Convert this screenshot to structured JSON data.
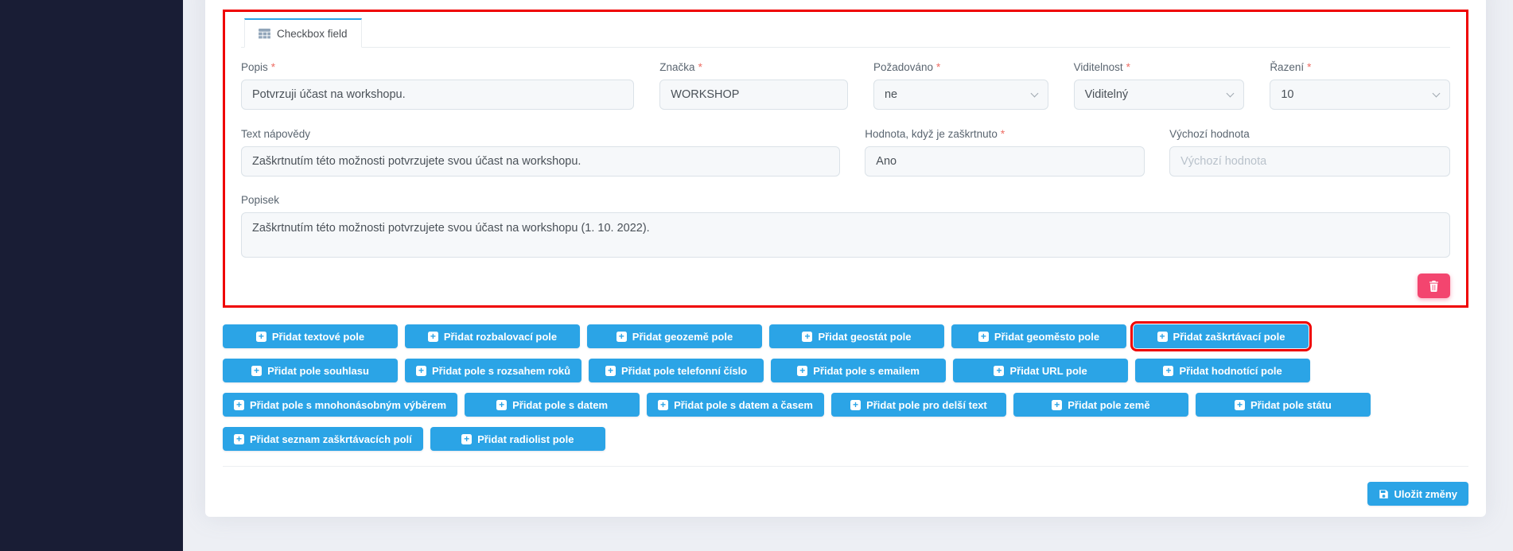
{
  "panel": {
    "tab_label": "Checkbox field"
  },
  "icons": {
    "plus": "+"
  },
  "form": {
    "required_marker": "*",
    "fields": {
      "popis": {
        "label": "Popis",
        "value": "Potvrzuji účast na workshopu."
      },
      "znacka": {
        "label": "Značka",
        "value": "WORKSHOP"
      },
      "pozadovano": {
        "label": "Požadováno",
        "value": "ne"
      },
      "viditelnost": {
        "label": "Viditelnost",
        "value": "Viditelný"
      },
      "razeni": {
        "label": "Řazení",
        "value": "10"
      },
      "text_napovedy": {
        "label": "Text nápovědy",
        "value": "Zaškrtnutím této možnosti potvrzujete svou účast na workshopu."
      },
      "hodnota_zaskrtnuto": {
        "label": "Hodnota, když je zaškrtnuto",
        "value": "Ano"
      },
      "vychozi_hodnota": {
        "label": "Výchozí hodnota",
        "value": "",
        "placeholder": "Výchozí hodnota"
      },
      "popisek": {
        "label": "Popisek",
        "value": "Zaškrtnutím této možnosti potvrzujete svou účast na workshopu (1. 10. 2022)."
      }
    }
  },
  "add_buttons": [
    {
      "label": "Přidat textové pole"
    },
    {
      "label": "Přidat rozbalovací pole"
    },
    {
      "label": "Přidat geozemě pole"
    },
    {
      "label": "Přidat geostát pole"
    },
    {
      "label": "Přidat geoměsto pole"
    },
    {
      "label": "Přidat zaškrtávací pole",
      "highlighted": true
    },
    {
      "label": "Přidat pole souhlasu"
    },
    {
      "label": "Přidat pole s rozsahem roků"
    },
    {
      "label": "Přidat pole telefonní číslo"
    },
    {
      "label": "Přidat pole s emailem"
    },
    {
      "label": "Přidat URL pole"
    },
    {
      "label": "Přidat hodnotící pole"
    },
    {
      "label": "Přidat pole s mnohonásobným výběrem"
    },
    {
      "label": "Přidat pole s datem"
    },
    {
      "label": "Přidat pole s datem a časem"
    },
    {
      "label": "Přidat pole pro delší text"
    },
    {
      "label": "Přidat pole země"
    },
    {
      "label": "Přidat pole státu"
    },
    {
      "label": "Přidat seznam zaškrtávacích polí"
    },
    {
      "label": "Přidat radiolist pole"
    }
  ],
  "footer": {
    "save_label": "Uložit změny"
  },
  "colors": {
    "accent_blue": "#2ba4e6",
    "danger_pink": "#f3456f",
    "highlight_red": "#ef0000",
    "sidebar_navy": "#191d35"
  }
}
